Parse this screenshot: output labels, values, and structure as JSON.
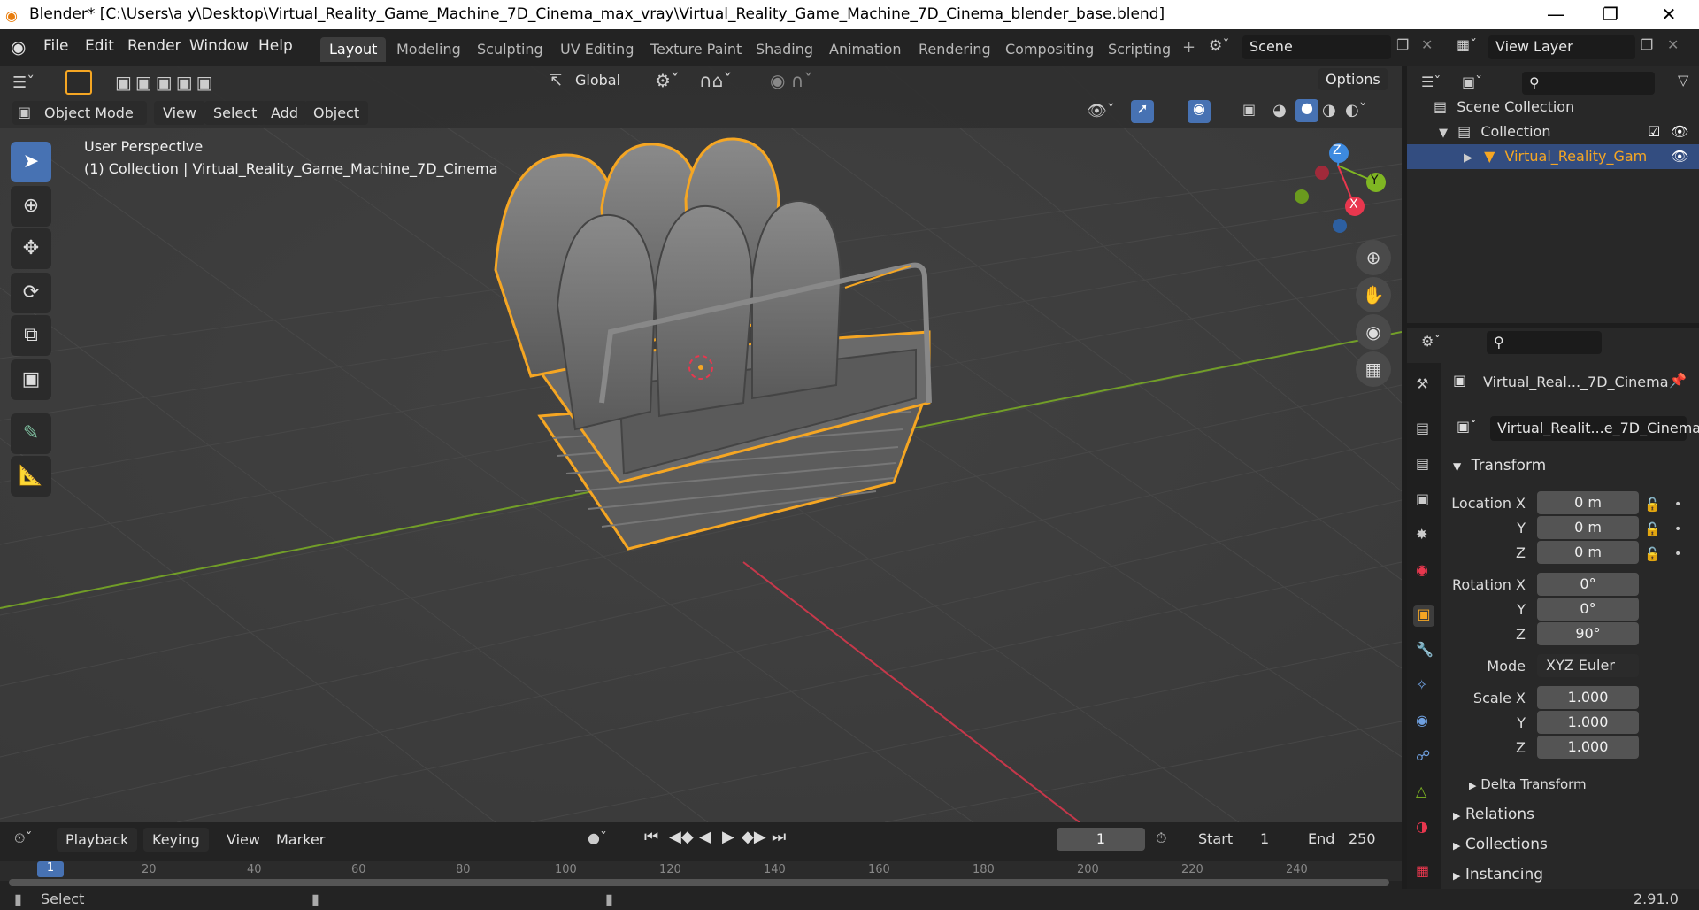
{
  "window": {
    "title": "Blender* [C:\\Users\\a y\\Desktop\\Virtual_Reality_Game_Machine_7D_Cinema_max_vray\\Virtual_Reality_Game_Machine_7D_Cinema_blender_base.blend]",
    "minimize": "—",
    "maximize": "❐",
    "close": "✕"
  },
  "menu": [
    "File",
    "Edit",
    "Render",
    "Window",
    "Help"
  ],
  "workspaces": [
    "Layout",
    "Modeling",
    "Sculpting",
    "UV Editing",
    "Texture Paint",
    "Shading",
    "Animation",
    "Rendering",
    "Compositing",
    "Scripting"
  ],
  "scene": {
    "name": "Scene",
    "view_layer": "View Layer"
  },
  "toolbar": {
    "orientation": "Global",
    "options": "Options"
  },
  "viewport_header": {
    "mode": "Object Mode",
    "menus": [
      "View",
      "Select",
      "Add",
      "Object"
    ]
  },
  "viewport": {
    "perspective": "User Perspective",
    "collection_info": "(1) Collection | Virtual_Reality_Game_Machine_7D_Cinema"
  },
  "gizmo": {
    "x": "X",
    "y": "Y",
    "z": "Z"
  },
  "outliner": {
    "scene_collection": "Scene Collection",
    "collection": "Collection",
    "object": "Virtual_Reality_Gam"
  },
  "properties": {
    "object_name": "Virtual_Real..._7D_Cinema",
    "data_name": "Virtual_Realit...e_7D_Cinema",
    "transform_title": "Transform",
    "location": {
      "label": "Location X",
      "x": "0 m",
      "y": "0 m",
      "z": "0 m"
    },
    "rotation": {
      "label": "Rotation X",
      "x": "0°",
      "y": "0°",
      "z": "90°"
    },
    "mode_label": "Mode",
    "mode_value": "XYZ Euler",
    "scale": {
      "label": "Scale X",
      "x": "1.000",
      "y": "1.000",
      "z": "1.000"
    },
    "axis_y": "Y",
    "axis_z": "Z",
    "sections": [
      "Delta Transform",
      "Relations",
      "Collections",
      "Instancing"
    ]
  },
  "timeline": {
    "menus": [
      "Playback",
      "Keying",
      "View",
      "Marker"
    ],
    "current_frame": "1",
    "start_label": "Start",
    "start": "1",
    "end_label": "End",
    "end": "250",
    "ruler": [
      "1",
      "20",
      "40",
      "60",
      "80",
      "100",
      "120",
      "140",
      "160",
      "180",
      "200",
      "220",
      "240"
    ]
  },
  "status": {
    "select": "Select",
    "version": "2.91.0"
  },
  "colors": {
    "accent": "#4772b3",
    "selection": "#f5a623",
    "x_axis": "#e8374e",
    "y_axis": "#7fb623",
    "z_axis": "#3d8ae0"
  }
}
